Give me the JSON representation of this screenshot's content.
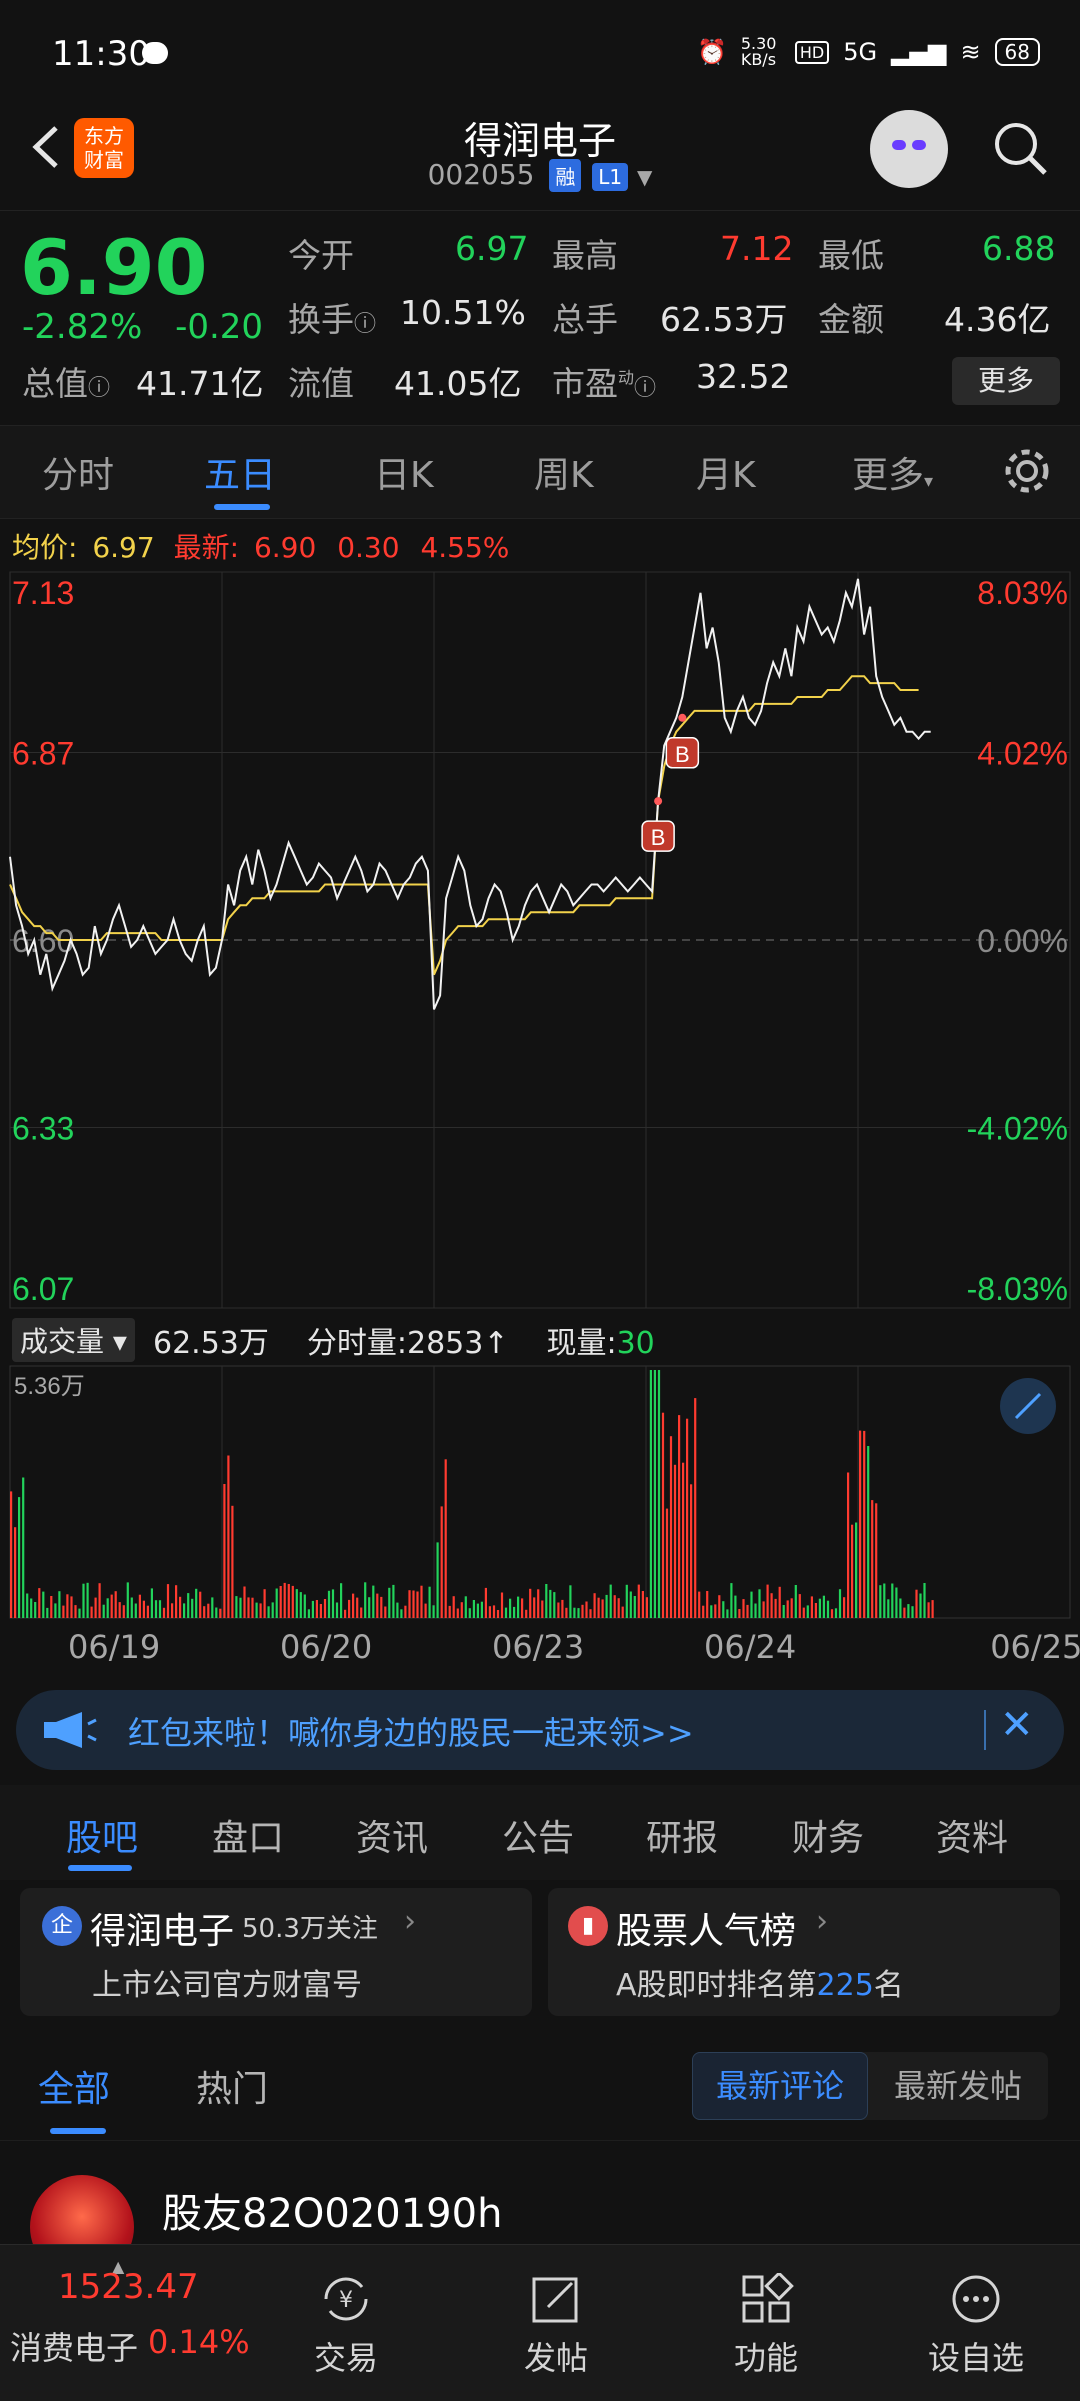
{
  "status_bar": {
    "time": "11:30",
    "net_speed": "5.30 KB/s",
    "network": "5G",
    "battery": "68"
  },
  "header": {
    "title": "得润电子",
    "code": "002055",
    "badge_rong": "融",
    "badge_level": "L1",
    "logo_text_1": "东方",
    "logo_text_2": "财富"
  },
  "quote": {
    "price": "6.90",
    "change_pct": "-2.82%",
    "change": "-0.20",
    "open_label": "今开",
    "open": "6.97",
    "high_label": "最高",
    "high": "7.12",
    "low_label": "最低",
    "low": "6.88",
    "turnover_label": "换手",
    "turnover": "10.51%",
    "volume_label": "总手",
    "volume": "62.53万",
    "amount_label": "金额",
    "amount": "4.36亿",
    "mktcap_label": "总值",
    "mktcap": "41.71亿",
    "float_label": "流值",
    "float_cap": "41.05亿",
    "pe_label": "市盈",
    "pe_sup": "动",
    "pe": "32.52",
    "more": "更多"
  },
  "tabs": [
    "分时",
    "五日",
    "日K",
    "周K",
    "月K",
    "更多"
  ],
  "legend": {
    "avg_label": "均价:",
    "avg": "6.97",
    "latest_label": "最新:",
    "latest": "6.90",
    "chg": "0.30",
    "pct": "4.55%"
  },
  "chart_data": {
    "type": "line",
    "y_left_ticks": [
      "7.13",
      "6.87",
      "6.60",
      "6.33",
      "6.07"
    ],
    "y_right_ticks": [
      "8.03%",
      "4.02%",
      "0.00%",
      "-4.02%",
      "-8.03%"
    ],
    "x_ticks": [
      "06/19",
      "06/20",
      "06/23",
      "06/24",
      "06/25"
    ],
    "ylim": [
      6.07,
      7.13
    ],
    "baseline": 6.6,
    "buy_marker": "B",
    "volume_max_label": "5.36万",
    "series": [
      {
        "values": [
          6.72,
          6.65,
          6.62,
          6.58,
          6.6,
          6.55,
          6.58,
          6.53,
          6.55,
          6.57,
          6.6,
          6.58,
          6.55,
          6.56,
          6.62,
          6.58,
          6.6,
          6.63,
          6.65,
          6.62,
          6.59,
          6.6,
          6.62,
          6.6,
          6.58,
          6.59,
          6.6,
          6.63,
          6.6,
          6.58,
          6.57,
          6.6,
          6.62,
          6.55,
          6.56,
          6.6,
          6.68,
          6.65,
          6.7,
          6.72,
          6.68,
          6.73,
          6.7,
          6.66,
          6.68,
          6.71,
          6.74,
          6.72,
          6.7,
          6.68,
          6.69,
          6.71,
          6.7,
          6.69,
          6.66,
          6.68,
          6.7,
          6.72,
          6.7,
          6.67,
          6.68,
          6.71,
          6.7,
          6.68,
          6.66,
          6.68,
          6.69,
          6.71,
          6.72,
          6.7,
          6.5,
          6.52,
          6.66,
          6.69,
          6.72,
          6.7,
          6.65,
          6.62,
          6.63,
          6.66,
          6.68,
          6.67,
          6.64,
          6.6,
          6.62,
          6.65,
          6.67,
          6.68,
          6.66,
          6.64,
          6.66,
          6.68,
          6.67,
          6.65,
          6.66,
          6.67,
          6.68,
          6.68,
          6.67,
          6.68,
          6.69,
          6.68,
          6.67,
          6.68,
          6.69,
          6.68,
          6.67,
          6.8,
          6.88,
          6.9,
          6.92,
          6.95,
          7.0,
          7.05,
          7.1,
          7.02,
          7.05,
          7.0,
          6.92,
          6.9,
          6.93,
          6.95,
          6.92,
          6.91,
          6.93,
          6.97,
          7.0,
          6.98,
          7.02,
          6.98,
          7.05,
          7.03,
          7.08,
          7.06,
          7.04,
          7.05,
          7.03,
          7.06,
          7.1,
          7.08,
          7.12,
          7.04,
          7.08,
          6.98,
          6.95,
          6.93,
          6.91,
          6.92,
          6.9,
          6.9,
          6.89,
          6.9,
          6.9
        ]
      },
      {
        "name": "均价",
        "values": [
          6.68,
          6.66,
          6.64,
          6.63,
          6.62,
          6.62,
          6.61,
          6.61,
          6.6,
          6.6,
          6.6,
          6.6,
          6.6,
          6.6,
          6.6,
          6.6,
          6.61,
          6.61,
          6.61,
          6.61,
          6.61,
          6.61,
          6.61,
          6.61,
          6.61,
          6.6,
          6.6,
          6.6,
          6.6,
          6.6,
          6.6,
          6.6,
          6.6,
          6.6,
          6.6,
          6.6,
          6.63,
          6.64,
          6.65,
          6.65,
          6.66,
          6.66,
          6.66,
          6.67,
          6.67,
          6.67,
          6.67,
          6.67,
          6.67,
          6.67,
          6.67,
          6.67,
          6.68,
          6.68,
          6.68,
          6.68,
          6.68,
          6.68,
          6.68,
          6.68,
          6.68,
          6.68,
          6.68,
          6.68,
          6.68,
          6.68,
          6.68,
          6.68,
          6.68,
          6.68,
          6.55,
          6.57,
          6.6,
          6.61,
          6.62,
          6.62,
          6.62,
          6.62,
          6.62,
          6.63,
          6.63,
          6.63,
          6.63,
          6.63,
          6.63,
          6.63,
          6.64,
          6.64,
          6.64,
          6.64,
          6.64,
          6.64,
          6.64,
          6.64,
          6.65,
          6.65,
          6.65,
          6.65,
          6.65,
          6.65,
          6.66,
          6.66,
          6.66,
          6.66,
          6.66,
          6.66,
          6.66,
          6.8,
          6.85,
          6.88,
          6.9,
          6.91,
          6.92,
          6.93,
          6.93,
          6.93,
          6.93,
          6.93,
          6.93,
          6.93,
          6.93,
          6.93,
          6.93,
          6.94,
          6.94,
          6.94,
          6.94,
          6.94,
          6.94,
          6.94,
          6.95,
          6.95,
          6.95,
          6.95,
          6.95,
          6.96,
          6.96,
          6.96,
          6.97,
          6.98,
          6.98,
          6.98,
          6.97,
          6.97,
          6.97,
          6.97,
          6.97,
          6.96,
          6.96,
          6.96,
          6.96
        ]
      }
    ]
  },
  "volume_bar": {
    "selector": "成交量",
    "total": "62.53万",
    "fenshi_label": "分时量:",
    "fenshi": "2853",
    "fenshi_arrow": "↑",
    "now_label": "现量:",
    "now": "30"
  },
  "banner": {
    "text": "红包来啦！喊你身边的股民一起来领>>"
  },
  "section_tabs": [
    "股吧",
    "盘口",
    "资讯",
    "公告",
    "研报",
    "财务",
    "资料"
  ],
  "cards": [
    {
      "icon": "企",
      "title": "得润电子",
      "meta": "50.3万关注",
      "sub": "上市公司官方财富号"
    },
    {
      "title": "股票人气榜",
      "sub_prefix": "A股即时排名第",
      "rank": "225",
      "sub_suffix": "名"
    }
  ],
  "filter": {
    "tabs": [
      "全部",
      "热门"
    ],
    "toggle": [
      "最新评论",
      "最新发帖"
    ]
  },
  "post": {
    "name": "股友82O020190h"
  },
  "bottom_nav": {
    "index_value": "1523.47",
    "index_name": "消费电子",
    "index_pct": "0.14%",
    "items": [
      "交易",
      "发帖",
      "功能",
      "设自选"
    ]
  },
  "colors": {
    "up": "#ff3b30",
    "down": "#22d35b",
    "accent": "#3b8cff",
    "avg_line": "#f2d24b"
  }
}
